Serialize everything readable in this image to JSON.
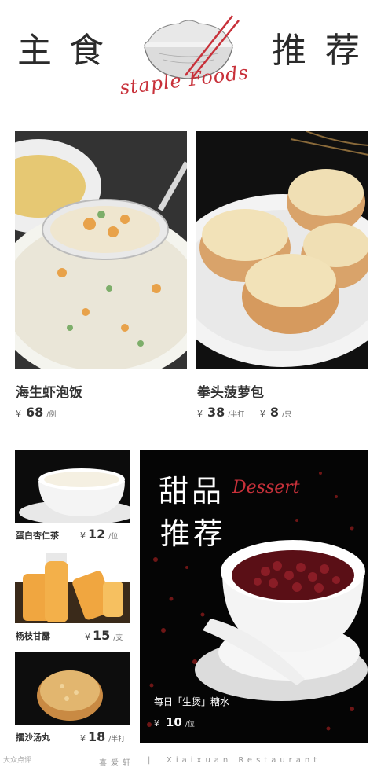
{
  "header": {
    "char1": "主",
    "char2": "食",
    "char3": "推",
    "char4": "荐",
    "script": "staple Foods"
  },
  "items": [
    {
      "name": "海生虾泡饭",
      "price": "68",
      "unit": "/例"
    },
    {
      "name": "拳头菠萝包",
      "price": "38",
      "unit": "/半打",
      "price2": "8",
      "unit2": "/只"
    }
  ],
  "small_items": [
    {
      "name": "蛋白杏仁茶",
      "price": "12",
      "unit": "/位"
    },
    {
      "name": "杨枝甘露",
      "price": "15",
      "unit": "/支"
    },
    {
      "name": "擂沙汤丸",
      "price": "18",
      "unit": "/半打"
    }
  ],
  "dessert": {
    "line1": "甜品",
    "line2": "推荐",
    "script": "Dessert",
    "caption": "每日「生煲」糖水",
    "price": "10",
    "unit": "/位"
  },
  "currency": "¥",
  "footer": {
    "brand": "喜爱轩",
    "separator": "|",
    "english": "Xiaixuan Restaurant"
  },
  "watermark": "大众点评",
  "colors": {
    "accent": "#c8313a",
    "text": "#333333"
  }
}
